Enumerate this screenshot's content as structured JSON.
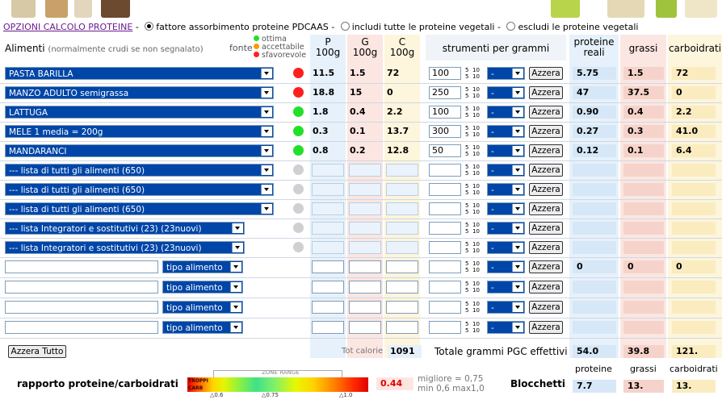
{
  "options": {
    "link": "OPZIONI CALCOLO PROTEINE",
    "dash": " -",
    "opt1": "fattore assorbimento proteine PDCAAS",
    "opt2": "includi tutte le proteine vegetali",
    "opt3": "escludi le proteine vegetali",
    "sep": "-"
  },
  "header": {
    "alimenti": "Alimenti",
    "note": "(normalmente crudi se non segnalato)",
    "fonte": "fonte",
    "legend": [
      "ottima",
      "accettabile",
      "sfavorevole"
    ],
    "p": "P",
    "g": "G",
    "c": "C",
    "unit": "100g",
    "strumenti": "strumenti per grammi",
    "proteine_reali": "proteine reali",
    "grassi": "grassi",
    "carboidrati": "carboidrati"
  },
  "colors": {
    "red": "#ff1f1f",
    "green": "#22e02a",
    "orange": "#ff9900",
    "grey": "#d0d0d0",
    "p_col": "#e6f1fb",
    "g_col": "#fbe6e1",
    "c_col": "#fdf5dc",
    "select_blue": "#0046a8"
  },
  "rows": [
    {
      "food": "PASTA BARILLA",
      "fonte": "red",
      "p": "11.5",
      "g": "1.5",
      "c": "72",
      "grams": "100",
      "prot": "5.75",
      "fat": "1.5",
      "carb": "72"
    },
    {
      "food": "MANZO ADULTO semigrassa",
      "fonte": "red",
      "p": "18.8",
      "g": "15",
      "c": "0",
      "grams": "250",
      "prot": "47",
      "fat": "37.5",
      "carb": "0"
    },
    {
      "food": "LATTUGA",
      "fonte": "green",
      "p": "1.8",
      "g": "0.4",
      "c": "2.2",
      "grams": "100",
      "prot": "0.90",
      "fat": "0.4",
      "carb": "2.2"
    },
    {
      "food": "MELE 1 media = 200g",
      "fonte": "green",
      "p": "0.3",
      "g": "0.1",
      "c": "13.7",
      "grams": "300",
      "prot": "0.27",
      "fat": "0.3",
      "carb": "41.0"
    },
    {
      "food": "MANDARANCI",
      "fonte": "green",
      "p": "0.8",
      "g": "0.2",
      "c": "12.8",
      "grams": "50",
      "prot": "0.12",
      "fat": "0.1",
      "carb": "6.4"
    },
    {
      "food": "--- lista di tutti gli alimenti (650)",
      "fonte": "grey",
      "p": "",
      "g": "",
      "c": "",
      "grams": "",
      "prot": "",
      "fat": "",
      "carb": ""
    },
    {
      "food": "--- lista di tutti gli alimenti (650)",
      "fonte": "grey",
      "p": "",
      "g": "",
      "c": "",
      "grams": "",
      "prot": "",
      "fat": "",
      "carb": ""
    },
    {
      "food": "--- lista di tutti gli alimenti (650)",
      "fonte": "grey",
      "p": "",
      "g": "",
      "c": "",
      "grams": "",
      "prot": "",
      "fat": "",
      "carb": ""
    },
    {
      "food": "--- lista Integratori e sostitutivi (23) (23nuovi)",
      "fonte": "grey",
      "p": "",
      "g": "",
      "c": "",
      "grams": "",
      "prot": "",
      "fat": "",
      "carb": ""
    },
    {
      "food": "--- lista Integratori e sostitutivi (23) (23nuovi)",
      "fonte": "grey",
      "p": "",
      "g": "",
      "c": "",
      "grams": "",
      "prot": "",
      "fat": "",
      "carb": ""
    }
  ],
  "custom_rows": [
    {
      "tipo": "tipo alimento",
      "prot": "0",
      "fat": "0",
      "carb": "0"
    },
    {
      "tipo": "tipo alimento",
      "prot": "",
      "fat": "",
      "carb": ""
    },
    {
      "tipo": "tipo alimento",
      "prot": "",
      "fat": "",
      "carb": ""
    },
    {
      "tipo": "tipo alimento",
      "prot": "",
      "fat": "",
      "carb": ""
    }
  ],
  "tools": {
    "dash": "-",
    "azzera": "Azzera",
    "spin5": "5",
    "spin10": "10"
  },
  "footer": {
    "azzera_tutto": "Azzera Tutto",
    "tot_calorie_label": "Tot calorie",
    "tot_calorie": "1091",
    "totale_label": "Totale grammi PGC effettivi",
    "tot_prot": "54.0",
    "tot_fat": "39.8",
    "tot_carb": "121.",
    "rapporto": "rapporto proteine/carboidrati",
    "zone": "ZONE RANGE",
    "troppi": "TROPPI",
    "carb_short": "CARB",
    "tick1": "△0.6",
    "tick2": "△0.75",
    "tick3": "△1.0",
    "ratio": "0.44",
    "migliore": "migliore = 0,75",
    "minmax": "min 0,6 max1,0",
    "blocchetti": "Blocchetti",
    "b_prot_label": "proteine",
    "b_fat_label": "grassi",
    "b_carb_label": "carboidrati",
    "b_prot": "7.7",
    "b_fat": "13.",
    "b_carb": "13."
  }
}
